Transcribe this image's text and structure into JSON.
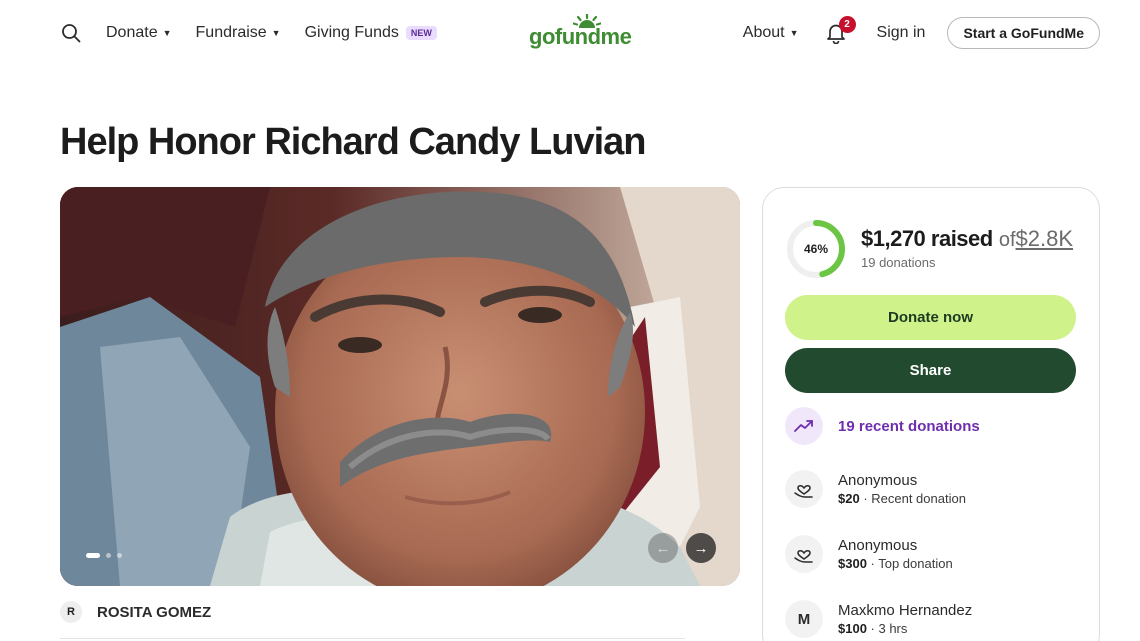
{
  "header": {
    "nav": {
      "donate": "Donate",
      "fundraise": "Fundraise",
      "giving_funds": "Giving Funds",
      "new_badge": "NEW"
    },
    "logo_text": "gofundme",
    "about": "About",
    "notification_count": "2",
    "sign_in": "Sign in",
    "start_button": "Start a GoFundMe"
  },
  "campaign": {
    "title": "Help Honor Richard Candy Luvian",
    "organizer_initial": "R",
    "organizer_name": "ROSITA GOMEZ",
    "carousel": {
      "slide_count": 3,
      "active_slide": 1,
      "prev_icon": "arrow-left-icon",
      "next_icon": "arrow-right-icon"
    }
  },
  "donation_card": {
    "percent_label": "46%",
    "percent_value": 0.46,
    "raised": "$1,270 raised",
    "of": "of",
    "goal": "$2.8K",
    "donations_count": "19 donations",
    "donate_button": "Donate now",
    "share_button": "Share",
    "recent_donations": "19 recent donations",
    "donors": [
      {
        "initial": "",
        "icon": "heart-hand-icon",
        "name": "Anonymous",
        "amount": "$20",
        "detail": " · Recent donation"
      },
      {
        "initial": "",
        "icon": "heart-hand-icon",
        "name": "Anonymous",
        "amount": "$300",
        "detail": " · Top donation"
      },
      {
        "initial": "M",
        "icon": "",
        "name": "Maxkmo Hernandez",
        "amount": "$100",
        "detail": " · 3 hrs"
      }
    ]
  },
  "colors": {
    "brand_green": "#3f8d33",
    "donate_button": "#cff28a",
    "share_button": "#224a2f",
    "accent_purple": "#6d2fb0",
    "notification_red": "#c8102e",
    "progress_green": "#6cc644"
  }
}
